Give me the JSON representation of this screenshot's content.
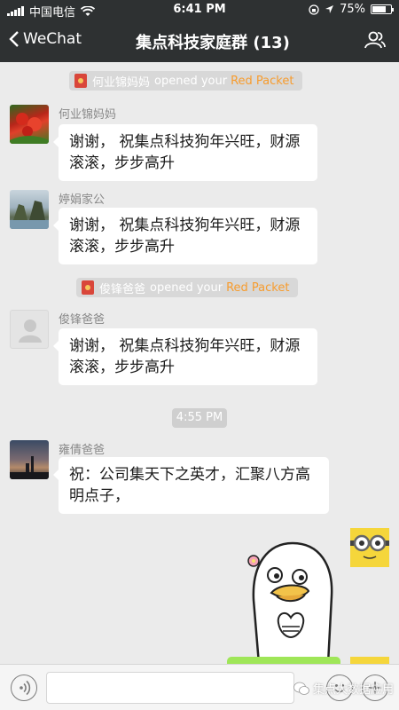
{
  "status_bar": {
    "carrier": "中国电信",
    "time": "6:41 PM",
    "battery": "75%",
    "battery_level": 0.75
  },
  "nav": {
    "back_label": "WeChat",
    "title": "集点科技家庭群 (13)"
  },
  "messages": [
    {
      "type": "notice",
      "name": "何业锦妈妈",
      "text": "opened your",
      "link": "Red Packet"
    },
    {
      "type": "text",
      "sender": "何业锦妈妈",
      "lines": [
        "谢谢， 祝集点科技狗年兴旺，财源",
        "滚滚，步步高升"
      ]
    },
    {
      "type": "text",
      "sender": "婷娟家公",
      "lines": [
        "谢谢， 祝集点科技狗年兴旺，财源",
        "滚滚，步步高升"
      ]
    },
    {
      "type": "notice",
      "name": "俊锋爸爸",
      "text": "opened your",
      "link": "Red Packet"
    },
    {
      "type": "text",
      "sender": "俊锋爸爸",
      "lines": [
        "谢谢， 祝集点科技狗年兴旺，财源",
        "滚滚，步步高升"
      ]
    },
    {
      "type": "time",
      "text": "4:55 PM"
    },
    {
      "type": "text",
      "sender": "雍倩爸爸",
      "lines": [
        "祝：公司集天下之英才，汇聚八方高",
        "明点子，"
      ]
    }
  ],
  "input": {
    "value": ""
  },
  "watermark": "集点大数据应用",
  "colors": {
    "header_bg": "#2e3132",
    "chat_bg": "#ebebeb",
    "red_packet": "#f79c2e",
    "sent_bubble": "#9fe658"
  },
  "icons": {
    "back": "chevron-left-icon",
    "group": "people-icon",
    "voice": "voice-icon",
    "emoji": "emoji-icon",
    "add": "plus-icon"
  }
}
